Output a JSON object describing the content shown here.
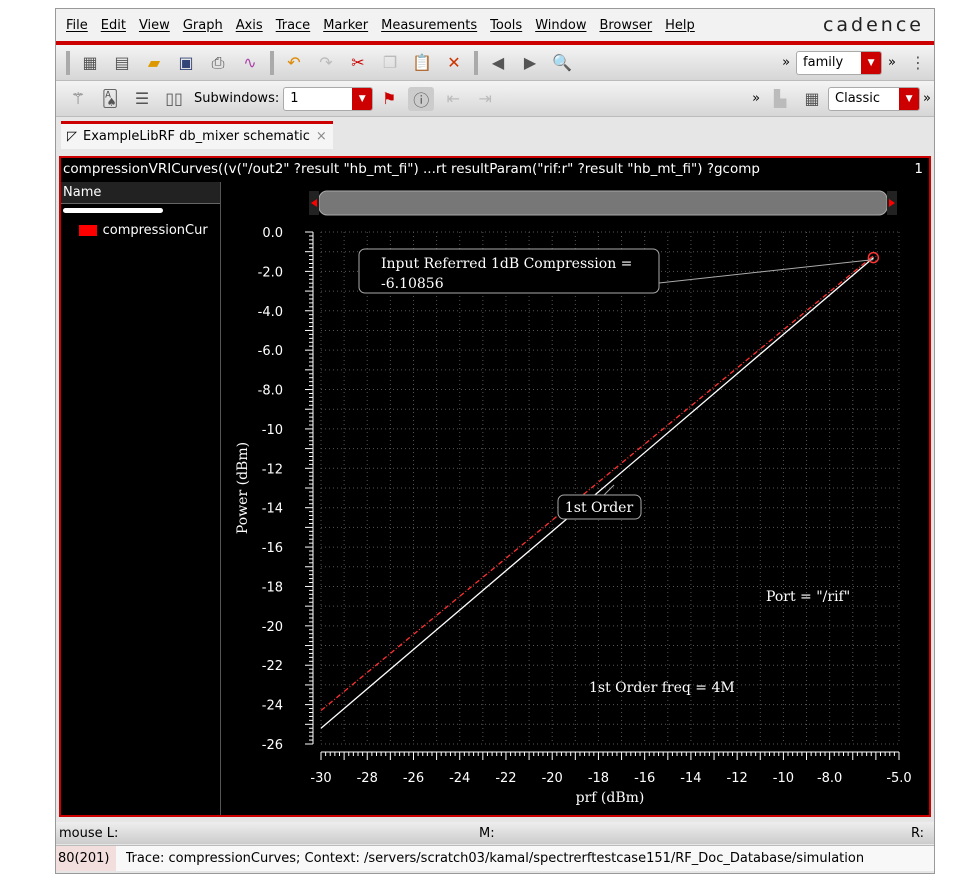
{
  "menu": [
    "File",
    "Edit",
    "View",
    "Graph",
    "Axis",
    "Trace",
    "Marker",
    "Measurements",
    "Tools",
    "Window",
    "Browser",
    "Help"
  ],
  "logo": "cadence",
  "toolbar": {
    "family_value": "family",
    "subwindows_label": "Subwindows:",
    "subwindows_value": "1",
    "style_value": "Classic",
    "more": "»"
  },
  "tab": {
    "label": "ExampleLibRF db_mixer schematic",
    "close": "×"
  },
  "expression": "compressionVRICurves((v(\"/out2\" ?result \"hb_mt_fi\") ...rt resultParam(\"rif:r\" ?result \"hb_mt_fi\") ?gcomp",
  "subwindow_number": "1",
  "legend": {
    "header": "Name",
    "items": [
      {
        "label": "compressionCur",
        "color": "#ff0000"
      }
    ]
  },
  "chart_data": {
    "type": "line",
    "xlabel": "prf (dBm)",
    "ylabel": "Power (dBm)",
    "xlim": [
      -30,
      -5
    ],
    "ylim": [
      -26,
      0
    ],
    "xticks": [
      "-30",
      "-28",
      "-26",
      "-24",
      "-22",
      "-20",
      "-18",
      "-16",
      "-14",
      "-12",
      "-10",
      "-8.0",
      "-5.0"
    ],
    "yticks": [
      "0.0",
      "-2.0",
      "-4.0",
      "-6.0",
      "-8.0",
      "-10",
      "-12",
      "-14",
      "-16",
      "-18",
      "-20",
      "-22",
      "-24",
      "-26"
    ],
    "grid": true,
    "series": [
      {
        "name": "1st Order",
        "color": "#ff3030",
        "style": "dashed",
        "x": [
          -30,
          -6.1
        ],
        "y": [
          -24.3,
          -1.2
        ]
      },
      {
        "name": "compressionCurves",
        "color": "#ffffff",
        "style": "solid",
        "x": [
          -30,
          -6.1
        ],
        "y": [
          -25.2,
          -1.3
        ]
      }
    ],
    "compression_point": {
      "x": -6.10856,
      "y": -1.3
    },
    "annotations": {
      "marker_line1": "Input Referred 1dB Compression =",
      "marker_line2": "-6.10856",
      "order_label": "1st Order",
      "port": "Port = \"/rif\"",
      "freq": "1st Order freq = 4M"
    }
  },
  "status": {
    "mouse_l": "mouse L:",
    "mouse_m": "M:",
    "mouse_r": "R:",
    "count": "80(201)",
    "message": "Trace: compressionCurves; Context: /servers/scratch03/kamal/spectrerftestcase151/RF_Doc_Database/simulation"
  }
}
